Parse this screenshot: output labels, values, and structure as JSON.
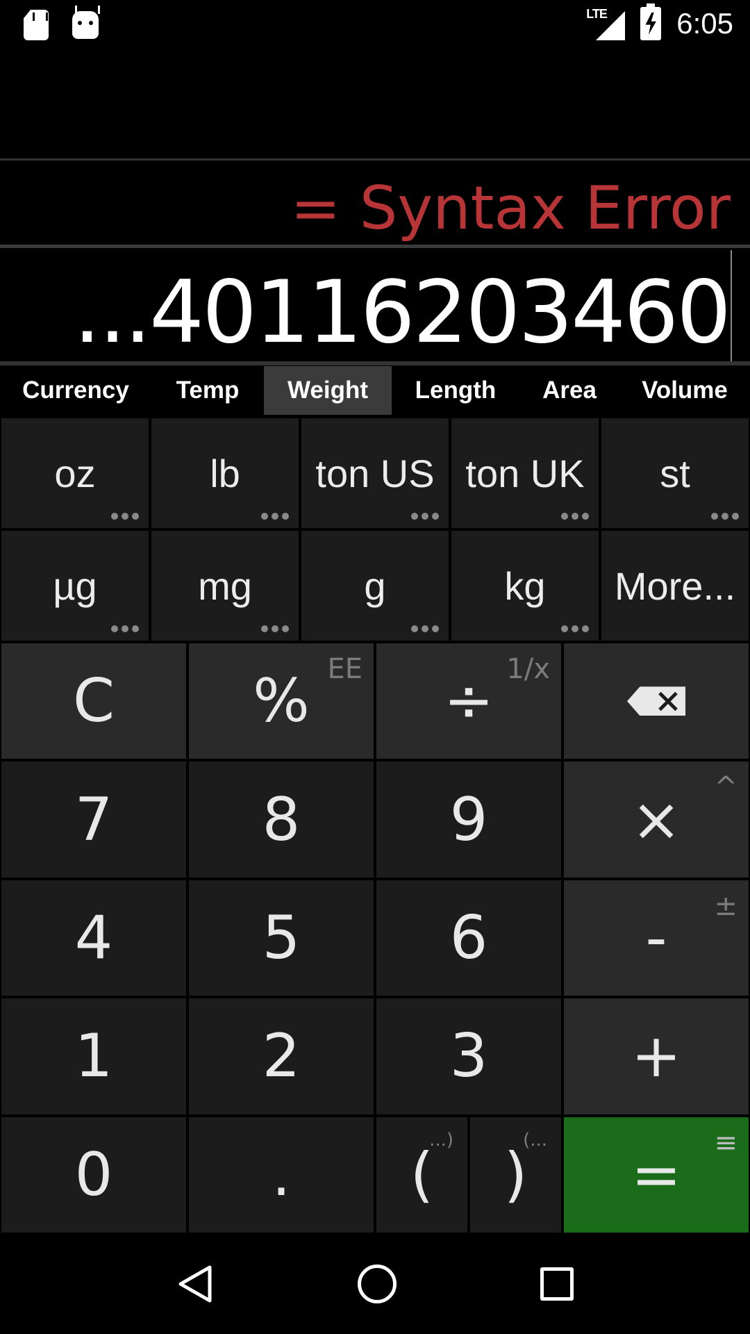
{
  "status_bar": {
    "time": "6:05",
    "network": "LTE"
  },
  "display": {
    "result": "= Syntax Error",
    "expression": "...40116203460",
    "result_color": "#b73437"
  },
  "tabs": [
    {
      "label": "Currency",
      "active": false
    },
    {
      "label": "Temp",
      "active": false
    },
    {
      "label": "Weight",
      "active": true
    },
    {
      "label": "Length",
      "active": false
    },
    {
      "label": "Area",
      "active": false
    },
    {
      "label": "Volume",
      "active": false
    }
  ],
  "units": {
    "row1": [
      "oz",
      "lb",
      "ton US",
      "ton UK",
      "st"
    ],
    "row2": [
      "µg",
      "mg",
      "g",
      "kg",
      "More..."
    ]
  },
  "keypad": {
    "clear": "C",
    "percent": "%",
    "percent_alt": "EE",
    "divide": "÷",
    "divide_alt": "1/x",
    "multiply": "×",
    "multiply_alt": "^",
    "minus": "-",
    "minus_alt": "±",
    "plus": "+",
    "equals": "=",
    "equals_alt": "≡",
    "dot": ".",
    "open_paren": "(",
    "open_paren_alt": "...)",
    "close_paren": ")",
    "close_paren_alt": "(...",
    "digits": [
      "7",
      "8",
      "9",
      "4",
      "5",
      "6",
      "1",
      "2",
      "3",
      "0"
    ]
  },
  "colors": {
    "equals_bg": "#1a6b1a",
    "key_bg": "#1c1c1c",
    "op_bg": "#2a2a2a"
  }
}
